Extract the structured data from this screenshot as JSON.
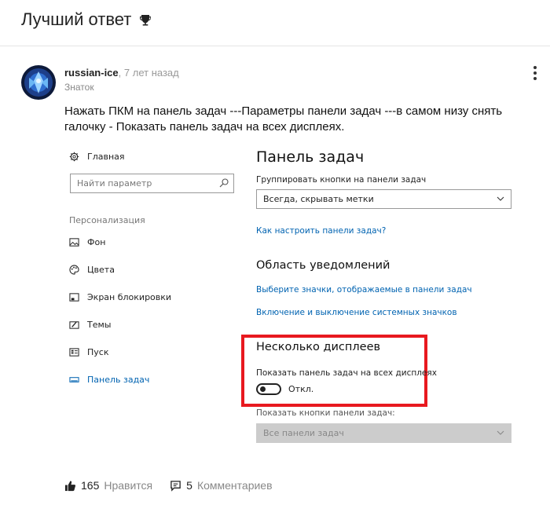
{
  "header": {
    "title": "Лучший ответ",
    "icon": "trophy-icon"
  },
  "answer": {
    "author": "russian-ice",
    "separator": ",",
    "time": "7 лет назад",
    "rank": "Знаток",
    "text": "Нажать ПКМ на панель задач ---Параметры панели задач ---в самом низу снять галочку - Показать панель задач на всех дисплеях."
  },
  "settings": {
    "sidebar": {
      "home": "Главная",
      "search_placeholder": "Найти параметр",
      "section": "Персонализация",
      "items": [
        {
          "label": "Фон",
          "icon": "image-icon"
        },
        {
          "label": "Цвета",
          "icon": "palette-icon"
        },
        {
          "label": "Экран блокировки",
          "icon": "lock-screen-icon"
        },
        {
          "label": "Темы",
          "icon": "themes-icon"
        },
        {
          "label": "Пуск",
          "icon": "start-icon"
        },
        {
          "label": "Панель задач",
          "icon": "taskbar-icon"
        }
      ],
      "active_index": 5
    },
    "panel_title": "Панель задач",
    "group_label": "Группировать кнопки на панели задач",
    "group_value": "Всегда, скрывать метки",
    "link_customize": "Как настроить панели задач?",
    "notify_title": "Область уведомлений",
    "link_select_icons": "Выберите значки, отображаемые в панели задач",
    "link_system_icons": "Включение и выключение системных значков",
    "multi_title": "Несколько дисплеев",
    "show_all_label": "Показать панель задач на всех дисплеях",
    "toggle_state": "Откл.",
    "toggle_on": false,
    "show_buttons_label": "Показать кнопки панели задач:",
    "show_buttons_value": "Все панели задач",
    "highlight_color": "#e8191f",
    "accent_color": "#0063b1"
  },
  "footer": {
    "likes": "165",
    "likes_label": "Нравится",
    "comments": "5",
    "comments_label": "Комментариев"
  }
}
